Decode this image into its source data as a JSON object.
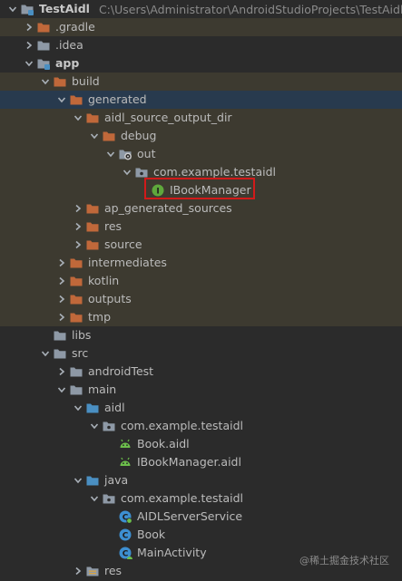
{
  "project_tree": {
    "rows": [
      {
        "label": "TestAidl",
        "path": "C:\\Users\\Administrator\\AndroidStudioProjects\\TestAidl",
        "icon": "module-folder-icon",
        "expanded": true,
        "bold": true
      },
      {
        "label": ".gradle",
        "icon": "folder-orange-icon",
        "expanded": false,
        "excluded": true
      },
      {
        "label": ".idea",
        "icon": "folder-gray-icon",
        "expanded": false
      },
      {
        "label": "app",
        "icon": "module-folder-icon",
        "expanded": true,
        "bold": true
      },
      {
        "label": "build",
        "icon": "folder-orange-icon",
        "expanded": true,
        "excluded": true
      },
      {
        "label": "generated",
        "icon": "folder-orange-icon",
        "expanded": true,
        "selected": true
      },
      {
        "label": "aidl_source_output_dir",
        "icon": "folder-orange-icon",
        "expanded": true,
        "excluded": true
      },
      {
        "label": "debug",
        "icon": "folder-orange-icon",
        "expanded": true,
        "excluded": true
      },
      {
        "label": "out",
        "icon": "generated-sources-folder-icon",
        "expanded": true,
        "excluded": true
      },
      {
        "label": "com.example.testaidl",
        "icon": "package-icon",
        "expanded": true,
        "excluded": true
      },
      {
        "label": "IBookManager",
        "icon": "interface-icon",
        "excluded": true
      },
      {
        "label": "ap_generated_sources",
        "icon": "folder-orange-icon",
        "expanded": false,
        "excluded": true
      },
      {
        "label": "res",
        "icon": "folder-orange-icon",
        "expanded": false,
        "excluded": true
      },
      {
        "label": "source",
        "icon": "folder-orange-icon",
        "expanded": false,
        "excluded": true
      },
      {
        "label": "intermediates",
        "icon": "folder-orange-icon",
        "expanded": false,
        "excluded": true
      },
      {
        "label": "kotlin",
        "icon": "folder-orange-icon",
        "expanded": false,
        "excluded": true
      },
      {
        "label": "outputs",
        "icon": "folder-orange-icon",
        "expanded": false,
        "excluded": true
      },
      {
        "label": "tmp",
        "icon": "folder-orange-icon",
        "expanded": false,
        "excluded": true
      },
      {
        "label": "libs",
        "icon": "folder-gray-icon"
      },
      {
        "label": "src",
        "icon": "folder-gray-icon",
        "expanded": true
      },
      {
        "label": "androidTest",
        "icon": "folder-gray-icon",
        "expanded": false
      },
      {
        "label": "main",
        "icon": "folder-gray-icon",
        "expanded": true
      },
      {
        "label": "aidl",
        "icon": "source-folder-icon",
        "expanded": true
      },
      {
        "label": "com.example.testaidl",
        "icon": "package-icon",
        "expanded": true
      },
      {
        "label": "Book.aidl",
        "icon": "android-file-icon"
      },
      {
        "label": "IBookManager.aidl",
        "icon": "android-file-icon"
      },
      {
        "label": "java",
        "icon": "source-folder-icon",
        "expanded": true
      },
      {
        "label": "com.example.testaidl",
        "icon": "package-icon",
        "expanded": true
      },
      {
        "label": "AIDLServerService",
        "icon": "service-class-icon"
      },
      {
        "label": "Book",
        "icon": "class-icon"
      },
      {
        "label": "MainActivity",
        "icon": "activity-class-icon"
      },
      {
        "label": "res",
        "icon": "resources-folder-icon",
        "expanded": false
      }
    ]
  },
  "watermark": {
    "text": "@稀土掘金技术社区"
  },
  "colors": {
    "background": "#2b2b2b",
    "excluded_row": "#3d3a30",
    "selected_row": "#283a4e",
    "folder_orange": "#c0683a",
    "folder_gray": "#8e99a6",
    "source_folder_blue": "#4a8fc2",
    "android_green": "#6cbf4b",
    "class_blue": "#3d8fd1",
    "interface_green": "#5fa83c",
    "highlight_border": "#d11a1a"
  }
}
